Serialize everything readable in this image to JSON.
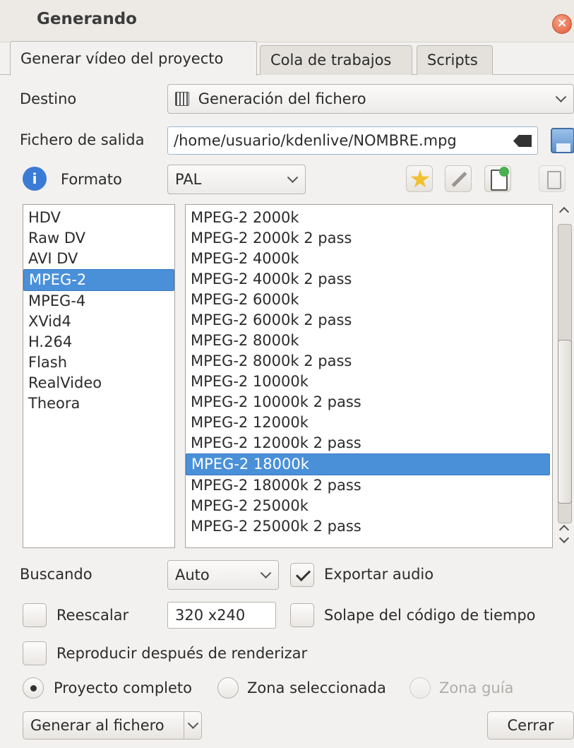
{
  "window": {
    "title": "Generando",
    "close_glyph": "×"
  },
  "tabs": [
    {
      "label": "Generar vídeo del proyecto",
      "active": true
    },
    {
      "label": "Cola de trabajos",
      "active": false
    },
    {
      "label": "Scripts",
      "active": false
    }
  ],
  "destination": {
    "label": "Destino",
    "value": "Generación del fichero",
    "icon": "film-icon"
  },
  "output_file": {
    "label": "Fichero de salida",
    "value": "/home/usuario/kdenlive/NOMBRE.mpg",
    "clear_icon": "clear-text-icon",
    "save_icon": "save-icon"
  },
  "format": {
    "label": "Formato",
    "value": "PAL",
    "info_icon": "info-icon",
    "tool_icons": [
      "favorite-star-icon",
      "edit-profile-icon",
      "new-profile-icon",
      "delete-profile-icon"
    ]
  },
  "categories": {
    "items": [
      "HDV",
      "Raw DV",
      "AVI DV",
      "MPEG-2",
      "MPEG-4",
      "XVid4",
      "H.264",
      "Flash",
      "RealVideo",
      "Theora"
    ],
    "selected_index": 3
  },
  "profiles": {
    "items": [
      "MPEG-2 2000k",
      "MPEG-2 2000k 2 pass",
      "MPEG-2 4000k",
      "MPEG-2 4000k 2 pass",
      "MPEG-2 6000k",
      "MPEG-2 6000k 2 pass",
      "MPEG-2 8000k",
      "MPEG-2 8000k 2 pass",
      "MPEG-2 10000k",
      "MPEG-2 10000k 2 pass",
      "MPEG-2 12000k",
      "MPEG-2 12000k 2 pass",
      "MPEG-2 18000k",
      "MPEG-2 18000k 2 pass",
      "MPEG-2 25000k",
      "MPEG-2 25000k 2 pass"
    ],
    "selected_index": 12
  },
  "options": {
    "seeking_label": "Buscando",
    "seeking_value": "Auto",
    "export_audio_label": "Exportar audio",
    "export_audio_checked": true,
    "rescale_label": "Reescalar",
    "rescale_checked": false,
    "rescale_value": "320 x240",
    "timecode_label": "Solape del código de tiempo",
    "timecode_checked": false,
    "play_after_label": "Reproducir después de renderizar",
    "play_after_checked": false
  },
  "range": {
    "full_project": "Proyecto completo",
    "selected_zone": "Zona seleccionada",
    "guide_zone": "Zona guía",
    "selected": "full_project"
  },
  "actions": {
    "render_button": "Generar al fichero",
    "close_button": "Cerrar"
  },
  "colors": {
    "selection": "#4a90d9",
    "close_button": "#e05a33",
    "window_bg": "#f2f1f0"
  }
}
